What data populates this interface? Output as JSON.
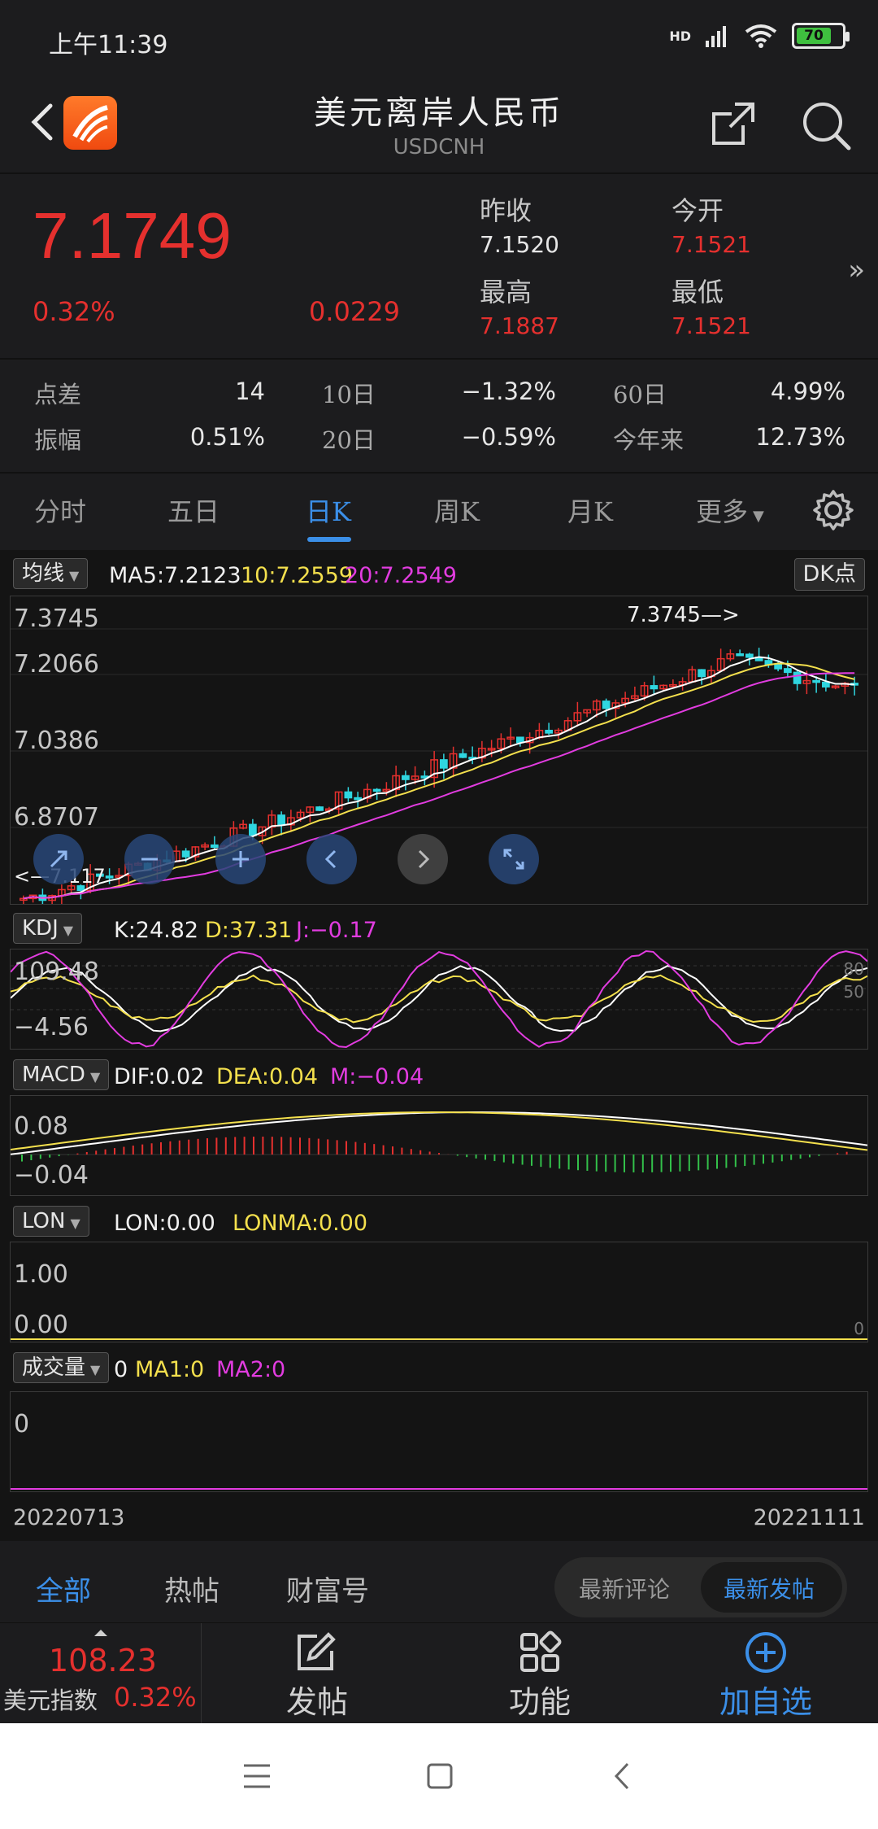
{
  "status": {
    "time": "上午11:39",
    "battery": "70",
    "network": "HD"
  },
  "header": {
    "title": "美元离岸人民币",
    "subtitle": "USDCNH"
  },
  "quote": {
    "price": "7.1749",
    "pct": "0.32%",
    "change": "0.0229",
    "prev_close_label": "昨收",
    "prev_close": "7.1520",
    "open_label": "今开",
    "open": "7.1521",
    "high_label": "最高",
    "high": "7.1887",
    "low_label": "最低",
    "low": "7.1521",
    "more": "»"
  },
  "stats": {
    "spread_label": "点差",
    "spread": "14",
    "d10_label": "10日",
    "d10": "−1.32%",
    "d60_label": "60日",
    "d60": "4.99%",
    "amp_label": "振幅",
    "amp": "0.51%",
    "d20_label": "20日",
    "d20": "−0.59%",
    "ytd_label": "今年来",
    "ytd": "12.73%"
  },
  "tabs": [
    "分时",
    "五日",
    "日K",
    "周K",
    "月K",
    "更多"
  ],
  "ma": {
    "btn": "均线",
    "ma5": "MA5:7.2123",
    "ma10": "10:7.2559",
    "ma20": "20:7.2549",
    "dk": "DK点",
    "y_labels": [
      "7.3745",
      "7.2066",
      "7.0386",
      "6.8707"
    ],
    "peak_label": "7.3745—>",
    "low_label": "<—7.117"
  },
  "kdj": {
    "btn": "KDJ",
    "k": "K:24.82",
    "d": "D:37.31",
    "j": "J:−0.17",
    "y_top": "109.48",
    "y_bottom": "−4.56",
    "r80": "80",
    "r50": "50"
  },
  "macd": {
    "btn": "MACD",
    "dif": "DIF:0.02",
    "dea": "DEA:0.04",
    "m": "M:−0.04",
    "y_top": "0.08",
    "y_bottom": "−0.04"
  },
  "lon": {
    "btn": "LON",
    "lon": "LON:0.00",
    "lonma": "LONMA:0.00",
    "y_top": "1.00",
    "y_bottom": "0.00",
    "r0": "0"
  },
  "vol": {
    "btn": "成交量",
    "val": "0",
    "ma1": "MA1:0",
    "ma2": "MA2:0",
    "y": "0"
  },
  "dates": {
    "start": "20220713",
    "end": "20221111"
  },
  "feed": {
    "tabs": [
      "全部",
      "热帖",
      "财富号"
    ],
    "toggle": [
      "最新评论",
      "最新发帖"
    ]
  },
  "bottom": {
    "index_val": "108.23",
    "index_name": "美元指数",
    "index_pct": "0.32%",
    "post": "发帖",
    "func": "功能",
    "add": "加自选"
  },
  "colors": {
    "up": "#e5302e",
    "down": "#2fd6e0",
    "accent": "#3b8fe8",
    "ma5": "#ffffff",
    "ma10": "#f4e04d",
    "ma20": "#e23ce0"
  },
  "chart_data": {
    "type": "candlestick",
    "ylim": [
      6.85,
      7.4
    ],
    "y_ticks": [
      7.3745,
      7.2066,
      7.0386,
      6.8707
    ],
    "date_range": [
      "20220713",
      "20221111"
    ],
    "series": [
      {
        "name": "MA5",
        "last": 7.2123
      },
      {
        "name": "10",
        "last": 7.2559
      },
      {
        "name": "20",
        "last": 7.2549
      }
    ]
  }
}
